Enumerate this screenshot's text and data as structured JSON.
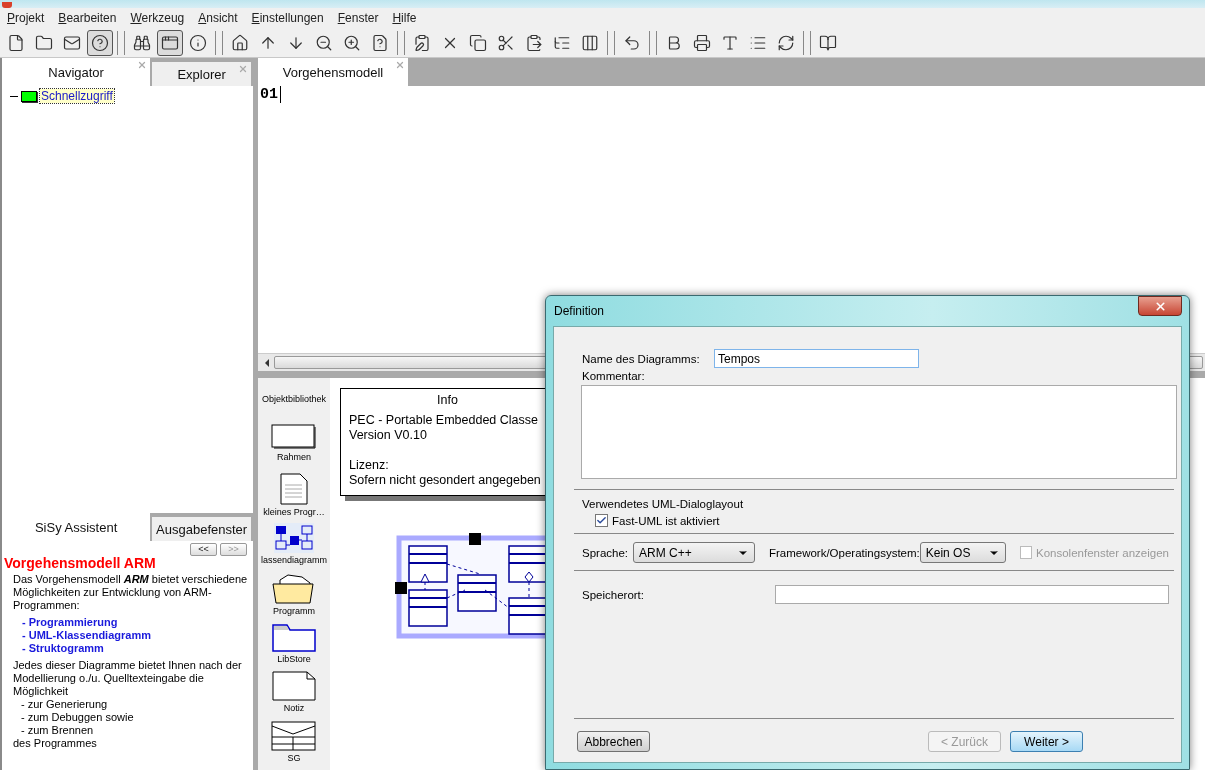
{
  "menu": [
    {
      "label": "Projekt"
    },
    {
      "label": "Bearbeiten"
    },
    {
      "label": "Werkzeug"
    },
    {
      "label": "Ansicht"
    },
    {
      "label": "Einstellungen"
    },
    {
      "label": "Fenster"
    },
    {
      "label": "Hilfe"
    }
  ],
  "toolbar": [
    [
      {
        "kind": "new",
        "pressed": false
      },
      {
        "kind": "open",
        "pressed": false
      },
      {
        "kind": "mail",
        "pressed": false
      },
      {
        "kind": "help",
        "pressed": true
      }
    ],
    [
      {
        "kind": "find",
        "pressed": false
      },
      {
        "kind": "window",
        "pressed": true
      },
      {
        "kind": "info",
        "pressed": false
      }
    ],
    [
      {
        "kind": "home",
        "pressed": false
      },
      {
        "kind": "up",
        "pressed": false
      },
      {
        "kind": "down",
        "pressed": false
      },
      {
        "kind": "zoom-out",
        "pressed": false
      },
      {
        "kind": "zoom-in",
        "pressed": false
      },
      {
        "kind": "doc-help",
        "pressed": false
      }
    ],
    [
      {
        "kind": "properties",
        "pressed": false
      },
      {
        "kind": "delete",
        "pressed": false
      },
      {
        "kind": "copy",
        "pressed": false
      },
      {
        "kind": "cut",
        "pressed": false
      },
      {
        "kind": "paste",
        "pressed": false
      },
      {
        "kind": "tree",
        "pressed": false
      },
      {
        "kind": "columns",
        "pressed": false
      }
    ],
    [
      {
        "kind": "undo",
        "pressed": false
      }
    ],
    [
      {
        "kind": "bold",
        "pressed": false
      },
      {
        "kind": "print",
        "pressed": false
      },
      {
        "kind": "font",
        "pressed": false
      },
      {
        "kind": "list",
        "pressed": false
      },
      {
        "kind": "refresh",
        "pressed": false
      }
    ],
    [
      {
        "kind": "book",
        "pressed": false
      }
    ]
  ],
  "navigator": {
    "tabs": [
      {
        "label": "Navigator",
        "selected": true
      },
      {
        "label": "Explorer",
        "selected": false
      }
    ],
    "tree": [
      {
        "label": "Schnellzugriff",
        "selected": true
      }
    ]
  },
  "assistant": {
    "tabs": [
      {
        "label": "SiSy Assistent",
        "selected": true
      },
      {
        "label": "Ausgabefenster",
        "selected": false
      }
    ],
    "nav_buttons": [
      {
        "label": "<<",
        "disabled": false
      },
      {
        "label": ">>",
        "disabled": true
      }
    ],
    "heading": "Vorgehensmodell ARM",
    "intro": "Das Vorgehensmodell **ARM** bietet verschiedene Möglichkeiten zur Entwicklung von ARM-Programmen:",
    "links": [
      "-  Programmierung",
      "-  UML-Klassendiagramm",
      "-  Struktogramm"
    ],
    "text": "Jedes dieser Diagramme bietet Ihnen nach der Modellierung o./u. Quelltexteingabe die Möglichkeit",
    "bullets": [
      "-  zur Generierung",
      "-  zum Debuggen sowie",
      "-  zum Brennen"
    ],
    "footer": "des Programmes"
  },
  "editor": {
    "tabs": [
      {
        "label": "Vorgehensmodell",
        "selected": true
      }
    ],
    "content": "01"
  },
  "library": {
    "title": "Objektbibliothek",
    "items": [
      {
        "kind": "frame",
        "label": "Rahmen"
      },
      {
        "kind": "document",
        "label": "kleines Progr…"
      },
      {
        "kind": "class-diagram",
        "label": "lassendiagramm",
        "selected": true
      },
      {
        "kind": "folder",
        "label": "Programm"
      },
      {
        "kind": "libstore",
        "label": "LibStore"
      },
      {
        "kind": "note",
        "label": "Notiz"
      },
      {
        "kind": "sg",
        "label": "SG"
      }
    ]
  },
  "info_note": {
    "title": "Info",
    "lines": [
      "PEC - Portable Embedded Classe",
      "Version V0.10",
      "Lizenz:",
      "Sofern nicht gesondert angegeben"
    ]
  },
  "dialog": {
    "title": "Definition",
    "name_label": "Name des Diagramms:",
    "name_value": "Tempos",
    "comment_label": "Kommentar:",
    "layout_label": "Verwendetes UML-Dialoglayout",
    "fast_uml": {
      "label": "Fast-UML ist aktiviert",
      "checked": true
    },
    "language_label": "Sprache:",
    "language": "ARM C++",
    "framework_label": "Framework/Operatingsystem:",
    "framework": "Kein OS",
    "console": {
      "label": "Konsolenfenster anzeigen",
      "checked": false,
      "disabled": true
    },
    "location_label": "Speicherort:",
    "buttons": [
      {
        "label": "Abbrechen",
        "kind": "cancel",
        "disabled": false
      },
      {
        "label": "< Zurück",
        "kind": "back",
        "disabled": true
      },
      {
        "label": "Weiter >",
        "kind": "next",
        "disabled": false
      }
    ]
  }
}
